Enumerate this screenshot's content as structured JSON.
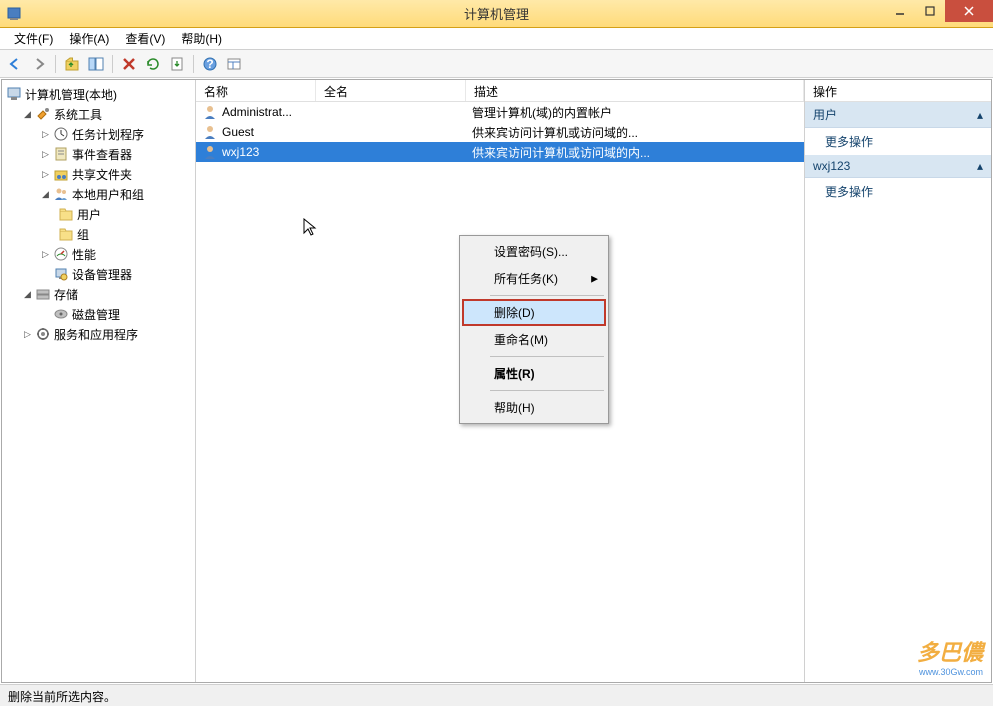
{
  "window": {
    "title": "计算机管理"
  },
  "menubar": {
    "file": "文件(F)",
    "action": "操作(A)",
    "view": "查看(V)",
    "help": "帮助(H)"
  },
  "tree": {
    "root": "计算机管理(本地)",
    "system_tools": "系统工具",
    "task_scheduler": "任务计划程序",
    "event_viewer": "事件查看器",
    "shared_folders": "共享文件夹",
    "local_users": "本地用户和组",
    "users": "用户",
    "groups": "组",
    "performance": "性能",
    "device_manager": "设备管理器",
    "storage": "存储",
    "disk_management": "磁盘管理",
    "services": "服务和应用程序"
  },
  "list": {
    "col_name": "名称",
    "col_fullname": "全名",
    "col_description": "描述",
    "rows": [
      {
        "name": "Administrat...",
        "fullname": "",
        "description": "管理计算机(域)的内置帐户"
      },
      {
        "name": "Guest",
        "fullname": "",
        "description": "供来宾访问计算机或访问域的..."
      },
      {
        "name": "wxj123",
        "fullname": "",
        "description": "供来宾访问计算机或访问域的内..."
      }
    ]
  },
  "context_menu": {
    "set_password": "设置密码(S)...",
    "all_tasks": "所有任务(K)",
    "delete": "删除(D)",
    "rename": "重命名(M)",
    "properties": "属性(R)",
    "help": "帮助(H)"
  },
  "actions": {
    "header": "操作",
    "section_users": "用户",
    "more_actions": "更多操作",
    "section_selected": "wxj123"
  },
  "statusbar": {
    "text": "删除当前所选内容。"
  },
  "watermark": {
    "main": "多巴儂",
    "sub": "www.30Gw.com"
  }
}
